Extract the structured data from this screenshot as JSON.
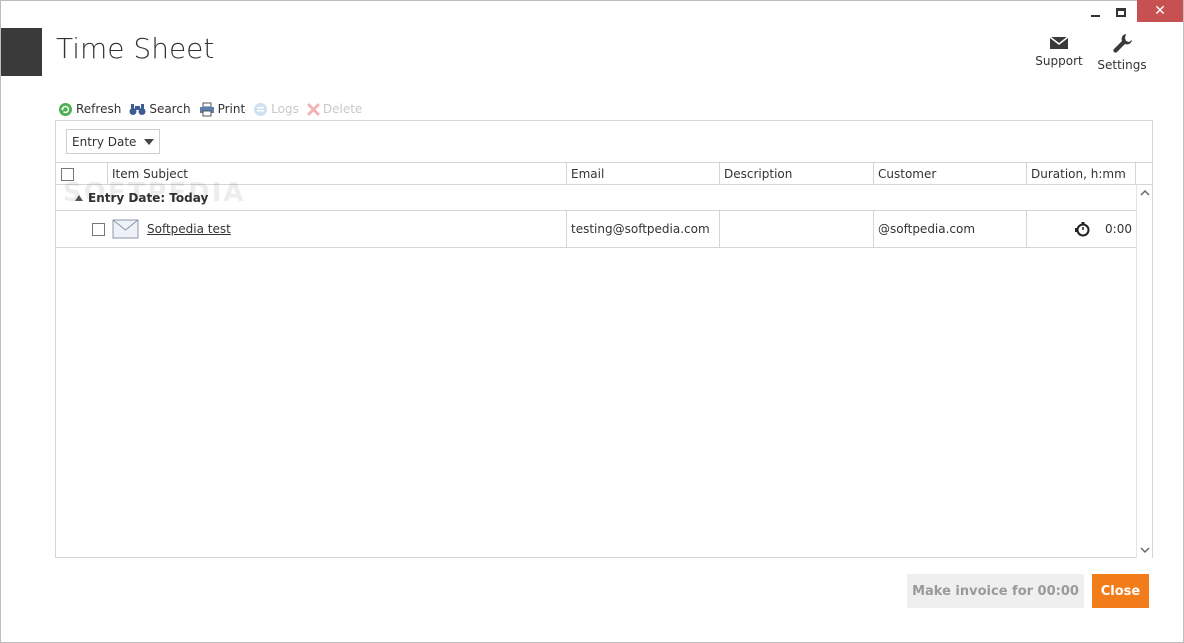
{
  "window": {
    "title": "Time Sheet",
    "close_glyph": "✕"
  },
  "header": {
    "support_label": "Support",
    "settings_label": "Settings",
    "support_icon": "envelope-icon",
    "settings_icon": "wrench-icon"
  },
  "toolbar": {
    "refresh_label": "Refresh",
    "search_label": "Search",
    "print_label": "Print",
    "logs_label": "Logs",
    "delete_label": "Delete"
  },
  "grid": {
    "group_by_value": "Entry Date",
    "columns": {
      "item_subject": "Item Subject",
      "email": "Email",
      "description": "Description",
      "customer": "Customer",
      "duration": "Duration, h:mm"
    },
    "group_label": "Entry Date: Today",
    "rows": [
      {
        "subject": "Softpedia test",
        "email": "testing@softpedia.com",
        "description": "",
        "customer": "@softpedia.com",
        "duration": "0:00"
      }
    ]
  },
  "footer": {
    "invoice_label": "Make invoice for  00:00",
    "close_label": "Close"
  },
  "watermark": "SOFTPEDIA",
  "colors": {
    "accent_block": "#3a3a3a",
    "close_button": "#f27b1a",
    "window_close": "#c75050",
    "disabled_text": "#c8c8c8"
  }
}
